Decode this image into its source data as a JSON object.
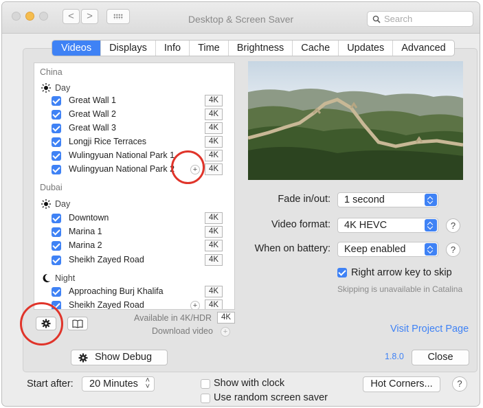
{
  "window": {
    "title": "Desktop & Screen Saver",
    "search_placeholder": "Search",
    "nav_back": "<",
    "nav_forward": ">"
  },
  "tabs": [
    "Videos",
    "Displays",
    "Info",
    "Time",
    "Brightness",
    "Cache",
    "Updates",
    "Advanced"
  ],
  "active_tab": "Videos",
  "video_list": {
    "groups": [
      {
        "name": "China",
        "sections": [
          {
            "name": "Day",
            "icon": "sun-icon",
            "items": [
              {
                "label": "Great Wall 1",
                "checked": true,
                "badge": "4K"
              },
              {
                "label": "Great Wall 2",
                "checked": true,
                "badge": "4K"
              },
              {
                "label": "Great Wall 3",
                "checked": true,
                "badge": "4K"
              },
              {
                "label": "Longji Rice Terraces",
                "checked": true,
                "badge": "4K"
              },
              {
                "label": "Wulingyuan National Park 1",
                "checked": true,
                "badge": "4K"
              },
              {
                "label": "Wulingyuan National Park 2",
                "checked": true,
                "badge": "4K",
                "plus": "+"
              }
            ]
          }
        ]
      },
      {
        "name": "Dubai",
        "sections": [
          {
            "name": "Day",
            "icon": "sun-icon",
            "items": [
              {
                "label": "Downtown",
                "checked": true,
                "badge": "4K"
              },
              {
                "label": "Marina 1",
                "checked": true,
                "badge": "4K"
              },
              {
                "label": "Marina 2",
                "checked": true,
                "badge": "4K"
              },
              {
                "label": "Sheikh Zayed Road",
                "checked": true,
                "badge": "4K"
              }
            ]
          },
          {
            "name": "Night",
            "icon": "moon-icon",
            "items": [
              {
                "label": "Approaching Burj Khalifa",
                "checked": true,
                "badge": "4K"
              },
              {
                "label": "Sheikh Zayed Road",
                "checked": true,
                "badge": "4K",
                "plus": "+"
              }
            ]
          }
        ]
      }
    ]
  },
  "list_footer": {
    "available_label": "Available in 4K/HDR",
    "available_badge": "4K",
    "download_label": "Download video",
    "download_plus": "+"
  },
  "settings": {
    "fade_label": "Fade in/out:",
    "fade_value": "1 second",
    "format_label": "Video format:",
    "format_value": "4K HEVC",
    "battery_label": "When on battery:",
    "battery_value": "Keep enabled",
    "help": "?",
    "arrow_skip_label": "Right arrow key to skip",
    "arrow_skip_checked": true,
    "skip_note": "Skipping is unavailable in Catalina",
    "project_link": "Visit Project Page"
  },
  "footer": {
    "debug_label": "Show Debug",
    "version": "1.8.0",
    "close_label": "Close"
  },
  "bottom": {
    "start_after_label": "Start after:",
    "start_after_value": "20 Minutes",
    "show_clock_label": "Show with clock",
    "random_label": "Use random screen saver",
    "hot_corners_label": "Hot Corners...",
    "help": "?"
  },
  "colors": {
    "accent": "#3f82f5",
    "annotation": "#e0342a"
  }
}
